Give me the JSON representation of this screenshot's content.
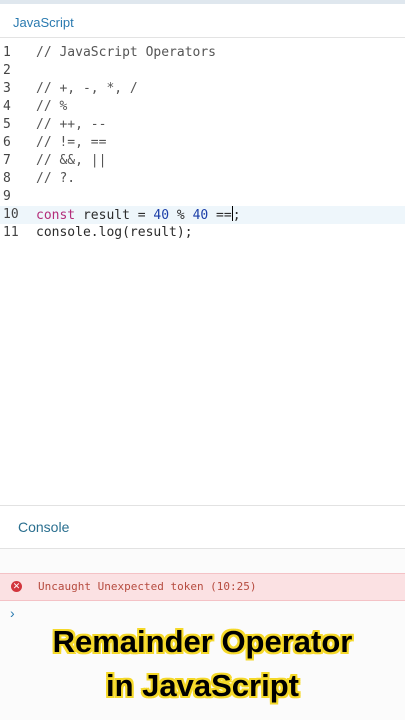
{
  "editor": {
    "tab_title": "JavaScript",
    "lines": [
      {
        "n": "1",
        "text": "// JavaScript Operators"
      },
      {
        "n": "2",
        "text": ""
      },
      {
        "n": "3",
        "text": "// +, -, *, /"
      },
      {
        "n": "4",
        "text": "// %"
      },
      {
        "n": "5",
        "text": "// ++, --"
      },
      {
        "n": "6",
        "text": "// !=, =="
      },
      {
        "n": "7",
        "text": "// &&, ||"
      },
      {
        "n": "8",
        "text": "// ?."
      },
      {
        "n": "9",
        "text": ""
      },
      {
        "n": "10",
        "kw": "const",
        "rest1": " result = ",
        "num1": "40",
        "op": " % ",
        "num2": "40",
        "tail": " ==",
        "end": ";"
      },
      {
        "n": "11",
        "text": "console.log(result);"
      }
    ]
  },
  "console": {
    "title": "Console",
    "error_message": "Uncaught Unexpected token (10:25)",
    "prompt_symbol": "›"
  },
  "caption": {
    "line1": "Remainder Operator",
    "line2": "in JavaScript"
  },
  "colors": {
    "accent": "#2a7ab0",
    "keyword": "#b32d7a",
    "error_bg": "#fbe1e3",
    "caption_outline": "#f5d92a"
  }
}
